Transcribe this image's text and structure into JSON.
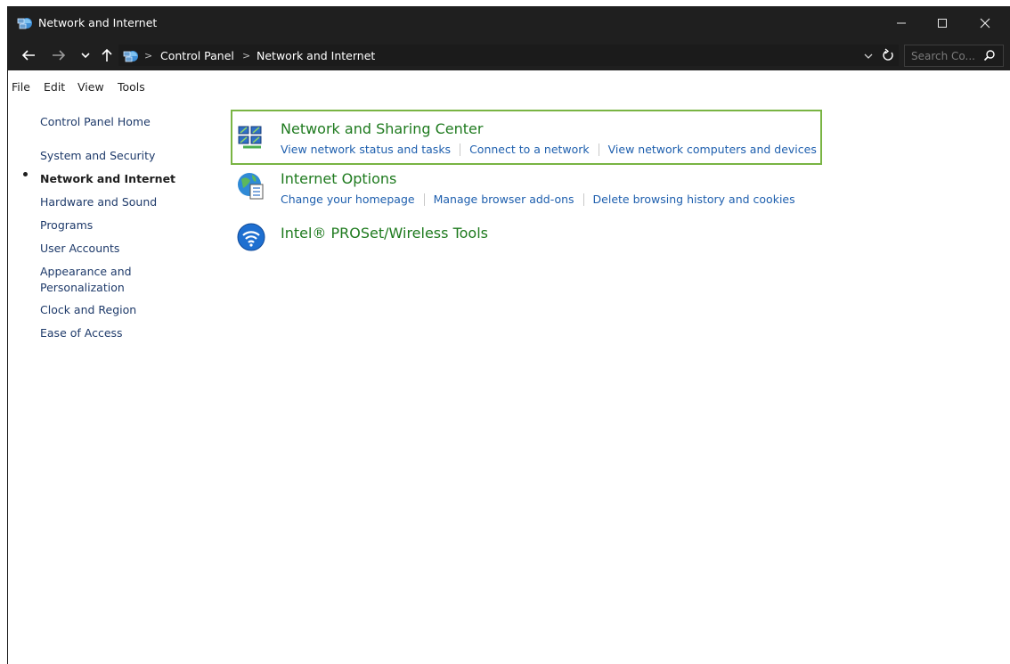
{
  "window": {
    "title": "Network and Internet",
    "controls": {
      "minimize": "—",
      "maximize": "☐",
      "close": "✕"
    }
  },
  "address_bar": {
    "breadcrumbs": [
      "Control Panel",
      "Network and Internet"
    ],
    "search_placeholder": "Search Co..."
  },
  "menu": [
    "File",
    "Edit",
    "View",
    "Tools"
  ],
  "left_nav": {
    "home": "Control Panel Home",
    "items": [
      "System and Security",
      "Network and Internet",
      "Hardware and Sound",
      "Programs",
      "User Accounts",
      "Appearance and Personalization",
      "Clock and Region",
      "Ease of Access"
    ],
    "appearance_line1": "Appearance and",
    "appearance_line2": "Personalization",
    "current_index": 1
  },
  "categories": [
    {
      "title": "Network and Sharing Center",
      "icon": "network-sharing-icon",
      "links": [
        "View network status and tasks",
        "Connect to a network",
        "View network computers and devices"
      ],
      "highlighted": true
    },
    {
      "title": "Internet Options",
      "icon": "internet-options-icon",
      "links": [
        "Change your homepage",
        "Manage browser add-ons",
        "Delete browsing history and cookies"
      ]
    },
    {
      "title": "Intel® PROSet/Wireless Tools",
      "icon": "wireless-tools-icon",
      "links": []
    }
  ],
  "colors": {
    "titlebar_bg": "#1f1f1f",
    "category_title": "#1e7a1e",
    "link": "#1e5fae",
    "highlight_border": "#79b443"
  }
}
